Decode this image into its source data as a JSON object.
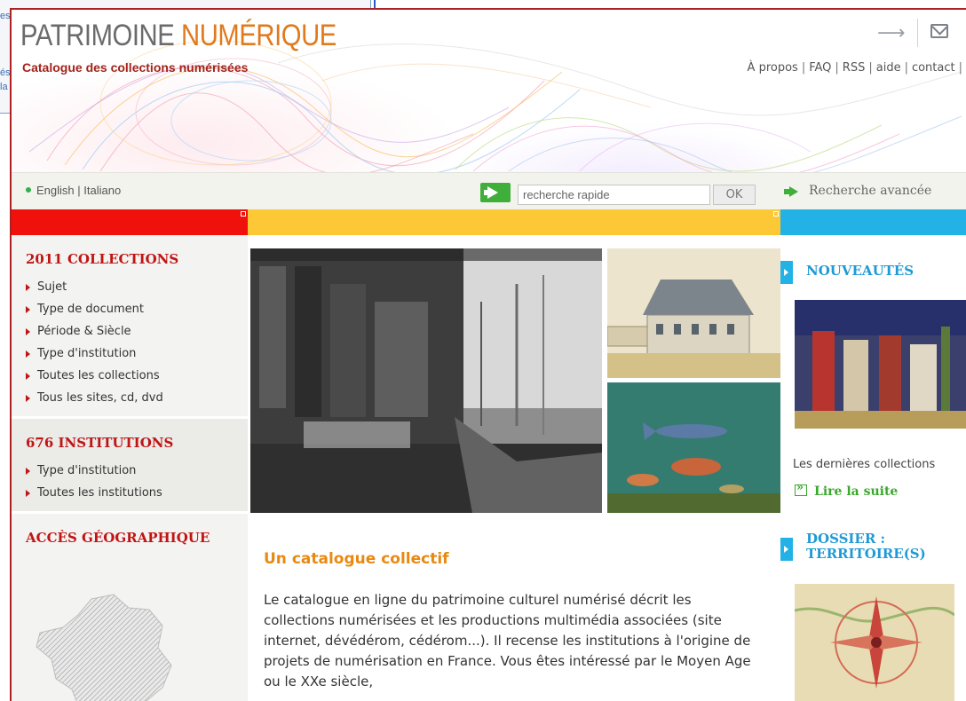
{
  "background_window": {
    "fragments": [
      "es",
      "és",
      "la"
    ]
  },
  "header": {
    "logo_part1": "PATRIMOINE ",
    "logo_part2": "NUMÉRIQUE",
    "subtitle": "Catalogue des collections numérisées",
    "top_links": [
      "À propos",
      "FAQ",
      "RSS",
      "aide",
      "contact"
    ]
  },
  "toolbar": {
    "languages": [
      "English",
      "Italiano"
    ],
    "search_placeholder": "recherche rapide",
    "ok_label": "OK",
    "advanced_search": "Recherche avancée"
  },
  "left": {
    "collections_title": "2011  COLLECTIONS",
    "collections_items": [
      "Sujet",
      "Type de document",
      "Période & Siècle",
      "Type d'institution",
      "Toutes les collections",
      "Tous les sites, cd, dvd"
    ],
    "institutions_title": "676  INSTITUTIONS",
    "institutions_items": [
      "Type d'institution",
      "Toutes les institutions"
    ],
    "geo_title": "ACCÈS GÉOGRAPHIQUE"
  },
  "center": {
    "article_title": "Un catalogue collectif",
    "article_body": "Le catalogue en ligne du patrimoine culturel numérisé décrit les collections numérisées et les productions multimédia associées (site internet, dévédérom, cédérom...). Il recense les institutions à l'origine de projets de numérisation en France. Vous êtes intéressé par le Moyen Age ou le XXe siècle,"
  },
  "right": {
    "news_title": "NOUVEAUTÉS",
    "last_collections": "Les dernières collections",
    "read_more": "Lire la suite",
    "dossier_title_line1": "DOSSIER :",
    "dossier_title_line2": "TERRITOIRE(S)"
  },
  "colors": {
    "band_red": "#f0100c",
    "band_yellow": "#fdc836",
    "band_blue": "#22b2e5",
    "accent_orange": "#e07a1c",
    "title_red": "#c01515",
    "link_green": "#3aa82c"
  }
}
